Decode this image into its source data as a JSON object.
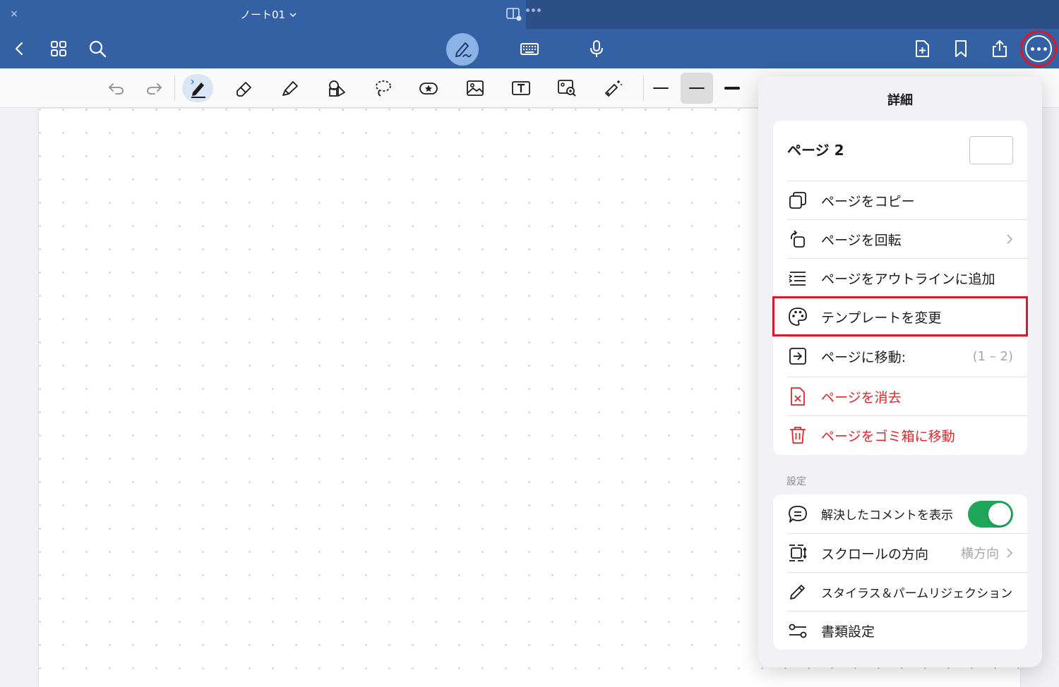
{
  "window": {
    "tab_close": "×",
    "title": "ノート01"
  },
  "colors": {
    "navbar": "#3461a3",
    "accent_red": "#e0162b",
    "destructive": "#e4262b",
    "toggle_on": "#1fa65b"
  },
  "navbar": {
    "left_icons": [
      "back-icon",
      "grid-icon",
      "search-icon"
    ],
    "center_icons": [
      "pen-mode-icon",
      "keyboard-icon",
      "microphone-icon"
    ],
    "right_icons": [
      "add-page-icon",
      "bookmark-icon",
      "share-icon",
      "more-icon"
    ]
  },
  "toolbar": {
    "tools": [
      "undo-icon",
      "redo-icon",
      "pen-icon",
      "eraser-icon",
      "highlighter-icon",
      "shapes-icon",
      "lasso-icon",
      "sticker-icon",
      "image-icon",
      "text-box-icon",
      "image-search-icon",
      "laser-pointer-icon"
    ],
    "selected_tool": "pen-icon",
    "selected_stroke": "medium"
  },
  "popover": {
    "title": "詳細",
    "page_header": "ページ 2",
    "items": [
      {
        "label": "ページをコピー",
        "icon": "copy-icon"
      },
      {
        "label": "ページを回転",
        "icon": "rotate-icon"
      },
      {
        "label": "ページをアウトラインに追加",
        "icon": "outline-icon"
      },
      {
        "label": "テンプレートを変更",
        "icon": "palette-icon"
      },
      {
        "label": "ページに移動:",
        "icon": "go-to-page-icon",
        "trail": "(1 – 2)"
      },
      {
        "label": "ページを消去",
        "icon": "clear-page-icon"
      },
      {
        "label": "ページをゴミ箱に移動",
        "icon": "trash-icon"
      }
    ],
    "settings_label": "設定",
    "settings": [
      {
        "label": "解決したコメントを表示",
        "icon": "comment-icon",
        "toggle_on": true
      },
      {
        "label": "スクロールの方向",
        "icon": "scroll-direction-icon",
        "value": "横方向"
      },
      {
        "label": "スタイラス＆パームリジェクション",
        "icon": "stylus-icon"
      },
      {
        "label": "書類設定",
        "icon": "document-settings-icon"
      }
    ]
  }
}
